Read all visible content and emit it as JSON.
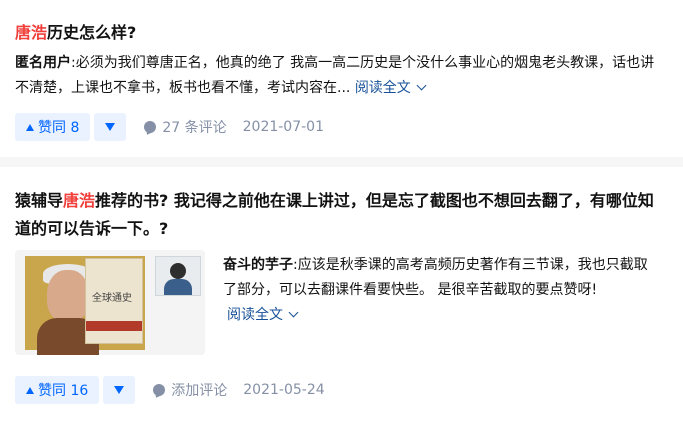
{
  "answers": [
    {
      "title_highlight": "唐浩",
      "title_rest": "历史怎么样?",
      "author": "匿名用户",
      "excerpt_line1": ":必须为我们尊唐正名，他真的绝了 我高一高二历史是个没什么事业心的烟鬼老头教课，话也讲",
      "excerpt_line2": "不清楚，上课也不拿书，板书也看不懂，考试内容在...",
      "read_more": "阅读全文",
      "vote_label": "赞同 8",
      "comment_label": "27 条评论",
      "date": "2021-07-01"
    },
    {
      "title_prefix": "猿辅导",
      "title_highlight": "唐浩",
      "title_rest_line1": "推荐的书? 我记得之前他在课上讲过，但是忘了截图也不想回去翻了，有哪位知",
      "title_rest_line2": "道的可以告诉一下。?",
      "author": "奋斗的芋子",
      "excerpt_line1": ":应该是秋季课的高考高频历史著作有三节课，我也只截取",
      "excerpt_line2": "了部分，可以去翻课件看要快些。 是很辛苦截取的要点赞呀!",
      "read_more": "阅读全文",
      "vote_label": "赞同 16",
      "comment_label": "添加评论",
      "date": "2021-05-24",
      "thumbnail_book_title": "全球通史"
    }
  ],
  "colors": {
    "highlight": "#f1403c",
    "link": "#175199",
    "vote_blue": "#0066ff",
    "vote_bg": "#eaf2ff",
    "meta_gray": "#8590a6"
  }
}
